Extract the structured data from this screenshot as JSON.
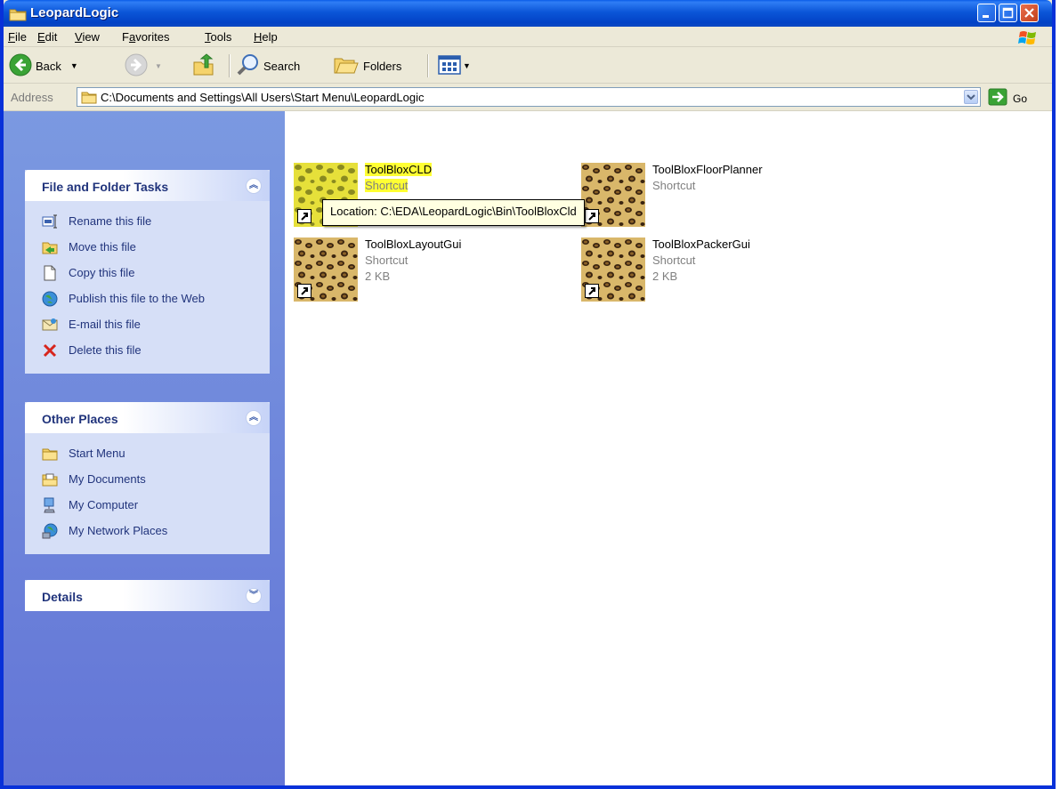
{
  "window": {
    "title": "LeopardLogic"
  },
  "menu": {
    "items": [
      {
        "label": "File",
        "ul": "F",
        "rest": "ile"
      },
      {
        "label": "Edit",
        "ul": "E",
        "rest": "dit"
      },
      {
        "label": "View",
        "ul": "V",
        "rest": "iew"
      },
      {
        "label": "Favorites",
        "pre": "F",
        "ul": "a",
        "rest": "vorites"
      },
      {
        "label": "Tools",
        "ul": "T",
        "rest": "ools"
      },
      {
        "label": "Help",
        "ul": "H",
        "rest": "elp"
      }
    ]
  },
  "toolbar": {
    "back_label": "Back",
    "search_label": "Search",
    "folders_label": "Folders"
  },
  "address": {
    "label": "Address",
    "value": "C:\\Documents and Settings\\All Users\\Start Menu\\LeopardLogic",
    "go_label": "Go"
  },
  "tasks_panel": {
    "title": "File and Folder Tasks",
    "items": [
      "Rename this file",
      "Move this file",
      "Copy this file",
      "Publish this file to the Web",
      "E-mail this file",
      "Delete this file"
    ]
  },
  "places_panel": {
    "title": "Other Places",
    "items": [
      "Start Menu",
      "My Documents",
      "My Computer",
      "My Network Places"
    ]
  },
  "details_panel": {
    "title": "Details"
  },
  "files": [
    {
      "name": "ToolBloxCLD",
      "type": "Shortcut",
      "size": "",
      "selected": true
    },
    {
      "name": "ToolBloxFloorPlanner",
      "type": "Shortcut",
      "size": ""
    },
    {
      "name": "ToolBloxLayoutGui",
      "type": "Shortcut",
      "size": "2 KB"
    },
    {
      "name": "ToolBloxPackerGui",
      "type": "Shortcut",
      "size": "2 KB"
    }
  ],
  "tooltip": {
    "text": "Location: C:\\EDA\\LeopardLogic\\Bin\\ToolBloxCld"
  },
  "colors": {
    "titlebar": "#0A5CE8",
    "taskpane": "#6F8BD8",
    "selection": "#FFFF33",
    "tooltip": "#FFFFE1"
  }
}
